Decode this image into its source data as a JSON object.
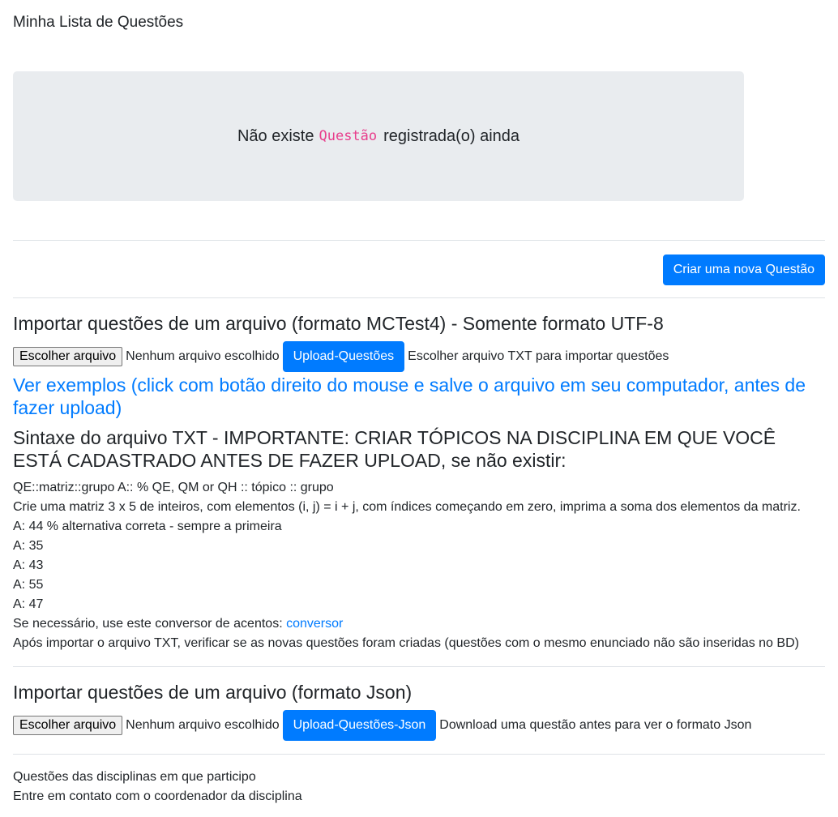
{
  "page_title": "Minha Lista de Questões",
  "empty_state": {
    "prefix": "Não existe",
    "entity": "Questão",
    "suffix": "registrada(o) ainda"
  },
  "new_question_button": "Criar uma nova Questão",
  "import_txt": {
    "title": "Importar questões de um arquivo (formato MCTest4) - Somente formato UTF-8",
    "choose_file_label": "Escolher arquivo",
    "no_file_text": "Nenhum arquivo escolhido",
    "upload_button": "Upload-Questões",
    "hint": "Escolher arquivo TXT para importar questões",
    "examples_link": "Ver exemplos (click com botão direito do mouse e salve o arquivo em seu computador, antes de fazer upload)"
  },
  "syntax": {
    "title": "Sintaxe do arquivo TXT - IMPORTANTE: CRIAR TÓPICOS NA DISCIPLINA EM QUE VOCÊ ESTÁ CADASTRADO ANTES DE FAZER UPLOAD, se não existir:",
    "lines": [
      "QE::matriz::grupo A:: % QE, QM or QH :: tópico :: grupo",
      "Crie uma matriz 3 x 5 de inteiros, com elementos (i, j) = i + j, com índices começando em zero, imprima a soma dos elementos da matriz.",
      "A: 44 % alternativa correta - sempre a primeira",
      "A: 35",
      "A: 43",
      "A: 55",
      "A: 47"
    ],
    "converter_prefix": "Se necessário, use este conversor de acentos:",
    "converter_link": "conversor",
    "after_import_note": "Após importar o arquivo TXT, verificar se as novas questões foram criadas (questões com o mesmo enunciado não são inseridas no BD)"
  },
  "import_json": {
    "title": "Importar questões de um arquivo (formato Json)",
    "choose_file_label": "Escolher arquivo",
    "no_file_text": "Nenhum arquivo escolhido",
    "upload_button": "Upload-Questões-Json",
    "hint": "Download uma questão antes para ver o formato Json"
  },
  "footer": {
    "line1": "Questões das disciplinas em que participo",
    "line2": "Entre em contato com o coordenador da disciplina"
  }
}
